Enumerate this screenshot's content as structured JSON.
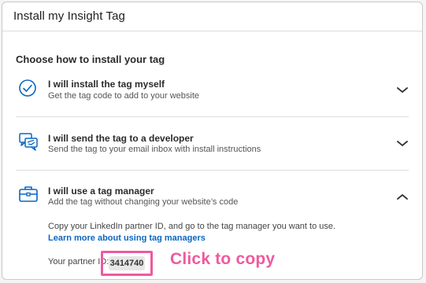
{
  "header": {
    "title": "Install my Insight Tag"
  },
  "main": {
    "section_title": "Choose how to install your tag",
    "options": [
      {
        "title": "I will install the tag myself",
        "subtitle": "Get the tag code to add to your website",
        "icon": "checkmark-circle-icon",
        "expanded": false
      },
      {
        "title": "I will send the tag to a developer",
        "subtitle": "Send the tag to your email inbox with install instructions",
        "icon": "chat-bubbles-icon",
        "expanded": false
      },
      {
        "title": "I will use a tag manager",
        "subtitle": "Add the tag without changing your website’s code",
        "icon": "briefcase-icon",
        "expanded": true
      }
    ],
    "tag_manager_detail": {
      "instructions": "Copy your LinkedIn partner ID, and go to the tag manager you want to use.",
      "learn_more_link": "Learn more about using tag managers",
      "partner_id_label": "Your partner ID:",
      "partner_id_value": "3414740"
    }
  },
  "annotation": {
    "text": "Click to copy",
    "color": "#ee5a9e"
  },
  "colors": {
    "accent": "#0a66c2",
    "icon": "#0a66c2",
    "highlight": "#ee5a9e"
  }
}
